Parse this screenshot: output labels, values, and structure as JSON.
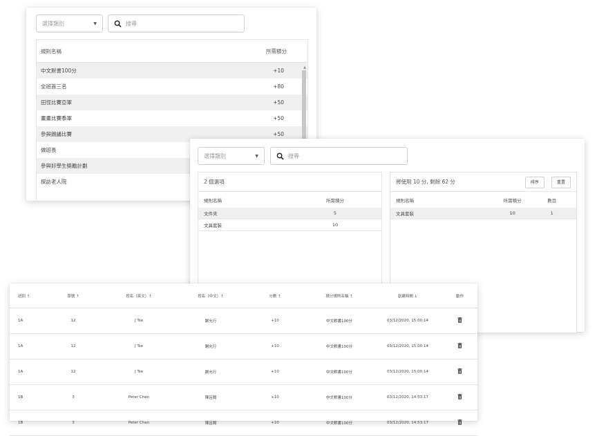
{
  "rules_card": {
    "category_placeholder": "選擇類別",
    "search_placeholder": "搜尋",
    "header_name": "規則名稱",
    "header_points": "所需積分",
    "rows": [
      {
        "name": "中文默書100分",
        "points": "+10"
      },
      {
        "name": "全班首三名",
        "points": "+80"
      },
      {
        "name": "田徑比賽亞軍",
        "points": "+50"
      },
      {
        "name": "畫畫比賽季軍",
        "points": "+50"
      },
      {
        "name": "參與朗誦比賽",
        "points": "+50"
      },
      {
        "name": "做班長",
        "points": ""
      },
      {
        "name": "參與好學生獎勵計劃",
        "points": ""
      },
      {
        "name": "探訪老人院",
        "points": ""
      }
    ]
  },
  "selection_card": {
    "category_placeholder": "選擇類別",
    "search_placeholder": "搜尋",
    "left_panel": {
      "title": "2 個選項",
      "header_name": "規則名稱",
      "header_points": "所需積分",
      "rows": [
        {
          "name": "文件夾",
          "points": "5"
        },
        {
          "name": "文具套裝",
          "points": "10"
        }
      ]
    },
    "right_panel": {
      "title": "將使用 10 分, 剩餘 62 分",
      "sort_button": "排序",
      "reset_button": "重置",
      "header_name": "規則名稱",
      "header_points": "所需積分",
      "header_qty": "數目",
      "rows": [
        {
          "name": "文具套裝",
          "points": "10",
          "qty": "1"
        }
      ]
    }
  },
  "records_table": {
    "headers": [
      "班別 ↑",
      "學號 ↑",
      "姓名（英文）↑",
      "姓名（中文）↑",
      "分數 ↑",
      "積分規則名稱 ↑",
      "創建時間 ↓",
      "動作"
    ],
    "rows": [
      [
        "1A",
        "12",
        "J Tse",
        "謝允行",
        "+10",
        "中文默書100分",
        "03/12/2020, 15:00:14"
      ],
      [
        "1A",
        "12",
        "J Tse",
        "謝允行",
        "+10",
        "中文默書100分",
        "03/12/2020, 15:00:14"
      ],
      [
        "1A",
        "12",
        "J Tse",
        "謝允行",
        "+10",
        "中文默書100分",
        "03/12/2020, 15:00:14"
      ],
      [
        "1B",
        "3",
        "Peter Chan",
        "陳呂聞",
        "+10",
        "中文默書100分",
        "03/12/2020, 14:53:17"
      ],
      [
        "1B",
        "3",
        "Peter Chan",
        "陳呂聞",
        "+10",
        "中文默書100分",
        "03/12/2020, 14:53:17"
      ]
    ],
    "action_icon": "trash-icon"
  }
}
